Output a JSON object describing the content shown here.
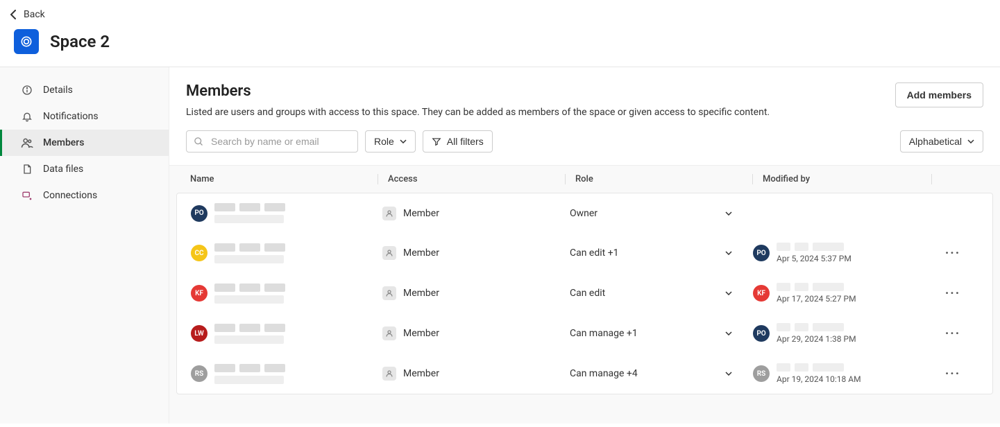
{
  "header": {
    "back_label": "Back",
    "space_title": "Space 2"
  },
  "sidebar": {
    "items": [
      {
        "label": "Details"
      },
      {
        "label": "Notifications"
      },
      {
        "label": "Members"
      },
      {
        "label": "Data files"
      },
      {
        "label": "Connections"
      }
    ]
  },
  "main": {
    "title": "Members",
    "description": "Listed are users and groups with access to this space. They can be added as members of the space or given access to specific content.",
    "add_button": "Add members",
    "search_placeholder": "Search by name or email",
    "role_filter_label": "Role",
    "all_filters_label": "All filters",
    "sort_label": "Alphabetical"
  },
  "columns": {
    "name": "Name",
    "access": "Access",
    "role": "Role",
    "modified_by": "Modified by"
  },
  "access_label": "Member",
  "rows": [
    {
      "avatar_initials": "PO",
      "avatar_color": "#1f3a5f",
      "role": "Owner",
      "has_role_dropdown": true,
      "modified_avatar_initials": "",
      "modified_avatar_color": "",
      "modified_date": "",
      "has_menu": false
    },
    {
      "avatar_initials": "CC",
      "avatar_color": "#f5c518",
      "role": "Can edit +1",
      "has_role_dropdown": true,
      "modified_avatar_initials": "PO",
      "modified_avatar_color": "#1f3a5f",
      "modified_date": "Apr 5, 2024 5:37 PM",
      "has_menu": true
    },
    {
      "avatar_initials": "KF",
      "avatar_color": "#e53935",
      "role": "Can edit",
      "has_role_dropdown": true,
      "modified_avatar_initials": "KF",
      "modified_avatar_color": "#e53935",
      "modified_date": "Apr 17, 2024 5:27 PM",
      "has_menu": true
    },
    {
      "avatar_initials": "LW",
      "avatar_color": "#b71c1c",
      "role": "Can manage +1",
      "has_role_dropdown": true,
      "modified_avatar_initials": "PO",
      "modified_avatar_color": "#1f3a5f",
      "modified_date": "Apr 29, 2024 1:38 PM",
      "has_menu": true
    },
    {
      "avatar_initials": "RS",
      "avatar_color": "#9e9e9e",
      "role": "Can manage +4",
      "has_role_dropdown": true,
      "modified_avatar_initials": "RS",
      "modified_avatar_color": "#9e9e9e",
      "modified_date": "Apr 19, 2024 10:18 AM",
      "has_menu": true
    }
  ]
}
